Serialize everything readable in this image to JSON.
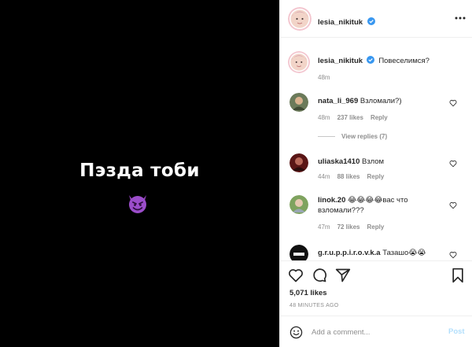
{
  "post": {
    "media_text": "Пэзда тоби",
    "media_emoji": "devil-emoji"
  },
  "header": {
    "username": "lesia_nikituk",
    "verified": true,
    "more_icon": "more-icon"
  },
  "caption": {
    "username": "lesia_nikituk",
    "text": "Повеселимся?",
    "time": "48m"
  },
  "comments": [
    {
      "username": "nata_li_969",
      "text": "Взломали?)",
      "time": "48m",
      "likes": "237 likes",
      "reply": "Reply"
    },
    {
      "username": "uliaska1410",
      "text": "Взлом",
      "time": "44m",
      "likes": "88 likes",
      "reply": "Reply"
    },
    {
      "username": "linok.20",
      "text": "😂😂😂😂вас что взломали???",
      "time": "47m",
      "likes": "72 likes",
      "reply": "Reply"
    },
    {
      "username": "g.r.u.p.p.i.r.o.v.k.a",
      "text": "Тазашо😭😭",
      "time": "",
      "likes": "",
      "reply": ""
    }
  ],
  "view_replies": "View replies (7)",
  "actions": {
    "likes": "5,071 likes",
    "time_ago": "48 MINUTES AGO"
  },
  "add_comment": {
    "placeholder": "Add a comment...",
    "post_label": "Post"
  },
  "colors": {
    "accent": "#0095f6",
    "verified": "#3897f0",
    "muted": "#8e8e8e",
    "media_bg": "#000000"
  }
}
